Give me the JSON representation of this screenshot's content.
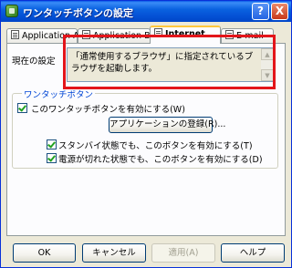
{
  "window": {
    "title": "ワンタッチボタンの設定"
  },
  "titlebar_buttons": {
    "help": "?",
    "close": "X"
  },
  "tabs": [
    {
      "label": "Application A",
      "active": false
    },
    {
      "label": "Application B",
      "active": false
    },
    {
      "label": "Internet",
      "active": true
    },
    {
      "label": "E-mail",
      "active": false
    }
  ],
  "current_setting": {
    "label": "現在の設定",
    "text": "「通常使用するブラウザ」に指定されているブラウザを起動します。"
  },
  "group": {
    "legend": "ワンタッチボタン",
    "enable_label": "このワンタッチボタンを有効にする(W)",
    "enable_checked": true,
    "register_button": "アプリケーションの登録(R)...",
    "standby_label": "スタンバイ状態でも、このボタンを有効にする(T)",
    "standby_checked": true,
    "poweroff_label": "電源が切れた状態でも、このボタンを有効にする(D)",
    "poweroff_checked": true
  },
  "buttons": {
    "ok": "OK",
    "cancel": "キャンセル",
    "apply": "適用(A)",
    "help": "ヘルプ"
  },
  "colors": {
    "highlight": "#e3151a",
    "titlebar": "#0a5ae8",
    "legend": "#0046d5",
    "checkmark": "#21a121"
  }
}
